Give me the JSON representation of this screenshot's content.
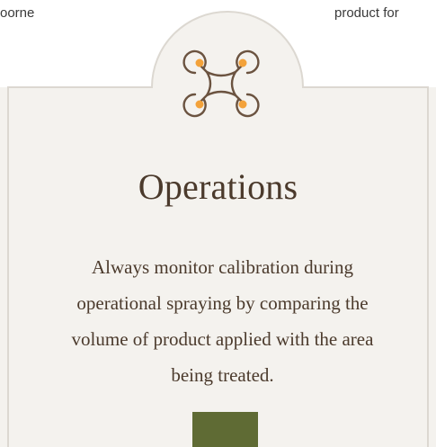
{
  "fragments": {
    "left_text": "oorne",
    "right_text": "product for"
  },
  "card": {
    "icon": "drone-icon",
    "title": "Operations",
    "body": "Always monitor calibration during operational spraying by comparing the volume of product applied with the area being treated."
  },
  "colors": {
    "card_background": "#f4f2ee",
    "card_border": "#dcd8d1",
    "text": "#4b3a2c",
    "icon_stroke": "#6b5340",
    "icon_accent": "#f3a23a",
    "button": "#5f6b34"
  }
}
